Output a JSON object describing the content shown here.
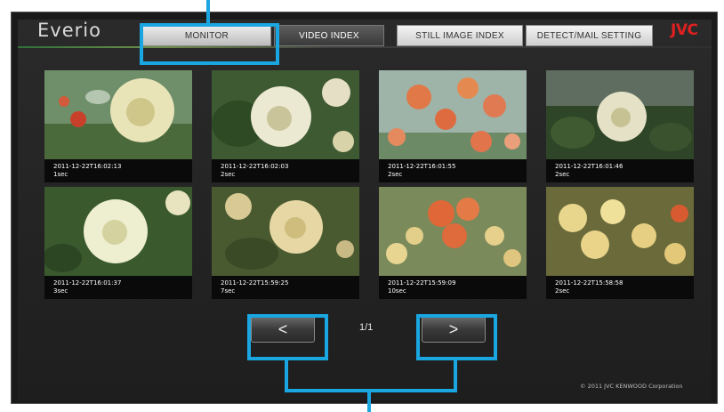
{
  "app": {
    "logo": "Everio",
    "brand": "JVC",
    "copyright": "© 2011 JVC KENWOOD Corporation"
  },
  "tabs": [
    {
      "label": "MONITOR",
      "state": "normal"
    },
    {
      "label": "VIDEO INDEX",
      "state": "active"
    },
    {
      "label": "STILL IMAGE INDEX",
      "state": "normal"
    },
    {
      "label": "DETECT/MAIL SETTING",
      "state": "normal"
    }
  ],
  "videos": [
    {
      "timestamp": "2011-12-22T16:02:13",
      "duration": "1sec"
    },
    {
      "timestamp": "2011-12-22T16:02:03",
      "duration": "2sec"
    },
    {
      "timestamp": "2011-12-22T16:01:55",
      "duration": "2sec"
    },
    {
      "timestamp": "2011-12-22T16:01:46",
      "duration": "2sec"
    },
    {
      "timestamp": "2011-12-22T16:01:37",
      "duration": "3sec"
    },
    {
      "timestamp": "2011-12-22T15:59:25",
      "duration": "7sec"
    },
    {
      "timestamp": "2011-12-22T15:59:09",
      "duration": "10sec"
    },
    {
      "timestamp": "2011-12-22T15:58:58",
      "duration": "2sec"
    }
  ],
  "pagination": {
    "prev_label": "<",
    "next_label": ">",
    "page": "1/1"
  },
  "colors": {
    "highlight": "#1aa6e0",
    "brand": "#e02020"
  }
}
